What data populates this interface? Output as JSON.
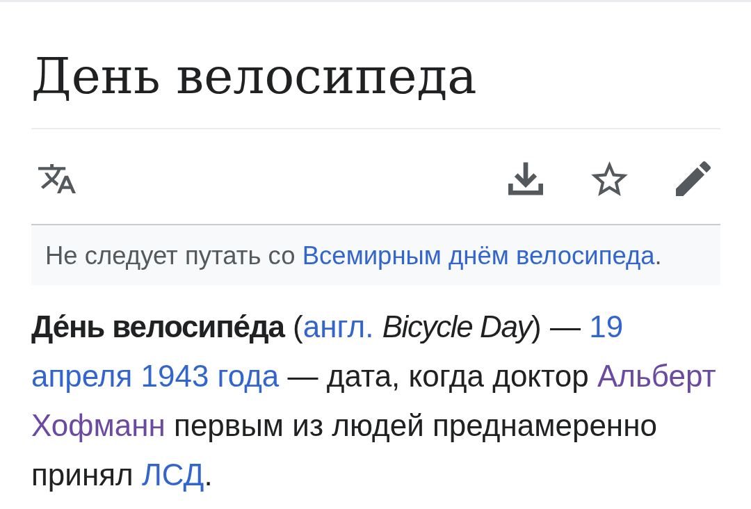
{
  "article": {
    "title": "День велосипеда",
    "actions": {
      "watched": false
    },
    "hatnote": {
      "runs": [
        {
          "kind": "text",
          "text": "Не следует путать со "
        },
        {
          "kind": "link",
          "text": "Всемирным днём велосипеда",
          "visited": false
        },
        {
          "kind": "text",
          "text": "."
        }
      ]
    },
    "lead": {
      "runs": [
        {
          "kind": "bold",
          "text": "Де́нь велосипе́да"
        },
        {
          "kind": "text",
          "text": " ("
        },
        {
          "kind": "link",
          "text": "англ.",
          "visited": false
        },
        {
          "kind": "italic",
          "text": "Bicycle Day"
        },
        {
          "kind": "text",
          "text": ") — "
        },
        {
          "kind": "link",
          "text": "19",
          "visited": false
        },
        {
          "kind": "link",
          "text": "апреля 1943 года",
          "visited": false
        },
        {
          "kind": "text",
          "text": " — дата, когда доктор "
        },
        {
          "kind": "link",
          "text": "Альберт",
          "visited": true
        },
        {
          "kind": "link",
          "text": "Хофманн",
          "visited": true
        },
        {
          "kind": "text",
          "text": " первым из людей преднамеренно принял "
        },
        {
          "kind": "link",
          "text": "ЛСД",
          "visited": false
        },
        {
          "kind": "text",
          "text": "."
        }
      ]
    }
  }
}
